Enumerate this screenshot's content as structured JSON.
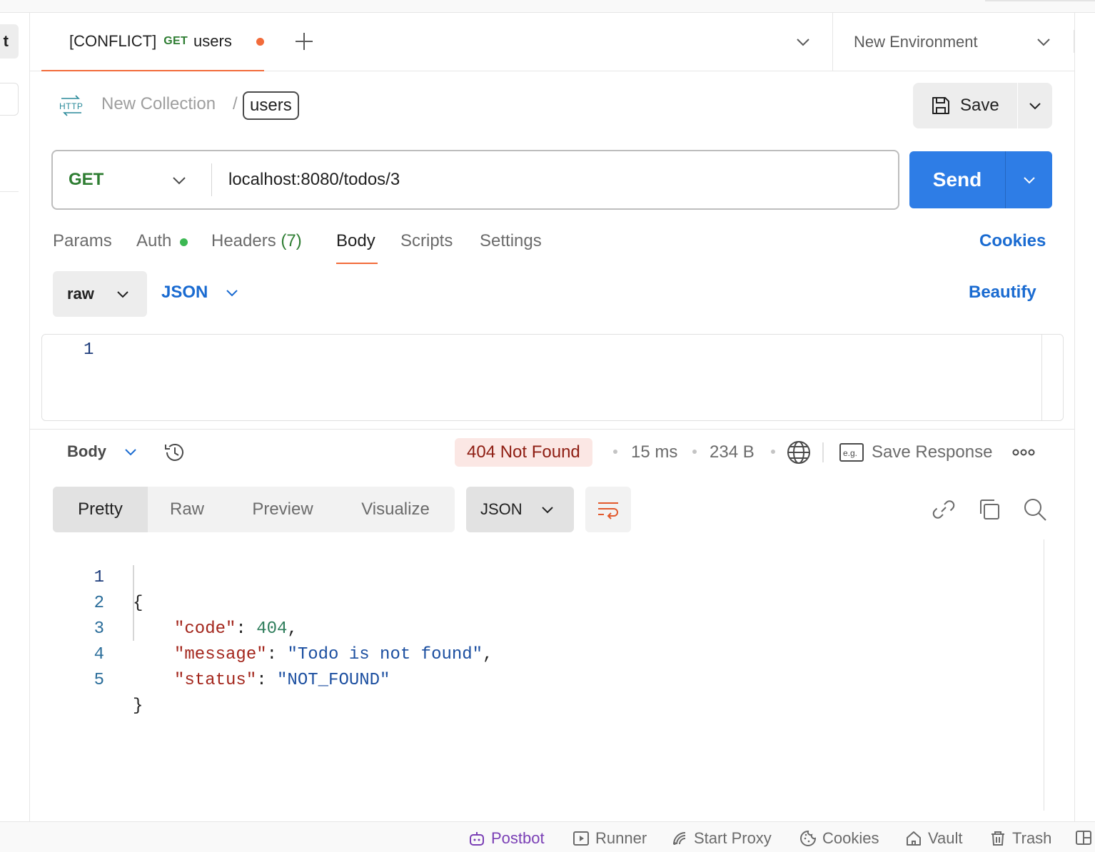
{
  "workspace": {
    "button_char": "t"
  },
  "tab": {
    "prefix": "[CONFLICT]",
    "method": "GET",
    "name": "users",
    "unsaved": true
  },
  "environment": {
    "label": "New Environment"
  },
  "breadcrumb": {
    "collection": "New Collection",
    "separator": "/",
    "request": "users"
  },
  "save": {
    "label": "Save"
  },
  "request": {
    "method": "GET",
    "url": "localhost:8080/todos/3",
    "send_label": "Send"
  },
  "request_tabs": {
    "params": "Params",
    "auth": "Auth",
    "headers": "Headers",
    "headers_count": "(7)",
    "body": "Body",
    "scripts": "Scripts",
    "settings": "Settings",
    "active": "Body"
  },
  "cookies_link": "Cookies",
  "body_options": {
    "mode": "raw",
    "language": "JSON",
    "beautify": "Beautify"
  },
  "request_editor": {
    "line_numbers": [
      "1"
    ]
  },
  "response": {
    "section_label": "Body",
    "status": "404 Not Found",
    "time": "15 ms",
    "size": "234 B",
    "save_response": "Save Response",
    "view_tabs": [
      "Pretty",
      "Raw",
      "Preview",
      "Visualize"
    ],
    "active_view": "Pretty",
    "format": "JSON",
    "lines": [
      {
        "n": "1",
        "text": "{"
      },
      {
        "n": "2",
        "key": "\"code\"",
        "value": "404",
        "trail": ","
      },
      {
        "n": "3",
        "key": "\"message\"",
        "value": "\"Todo is not found\"",
        "trail": ","
      },
      {
        "n": "4",
        "key": "\"status\"",
        "value": "\"NOT_FOUND\"",
        "trail": ""
      },
      {
        "n": "5",
        "text": "}"
      }
    ]
  },
  "statusbar": {
    "postbot": "Postbot",
    "runner": "Runner",
    "start_proxy": "Start Proxy",
    "cookies": "Cookies",
    "vault": "Vault",
    "trash": "Trash"
  },
  "colors": {
    "accent_orange": "#f26b3a",
    "send_blue": "#2e7de6",
    "link_blue": "#1a6bd1",
    "get_green": "#2e7d32",
    "error_bg": "#fbe7e4",
    "error_text": "#8e1d12",
    "postbot_purple": "#7a3fb5"
  },
  "icons": [
    "http-icon",
    "save-icon",
    "chevron-down-icon",
    "plus-icon",
    "history-icon",
    "globe-icon",
    "example-icon",
    "more-icon",
    "wrap-icon",
    "link-icon",
    "copy-icon",
    "search-icon",
    "postbot-icon",
    "runner-icon",
    "proxy-icon",
    "cookie-icon",
    "vault-icon",
    "trash-icon",
    "layout-icon"
  ]
}
